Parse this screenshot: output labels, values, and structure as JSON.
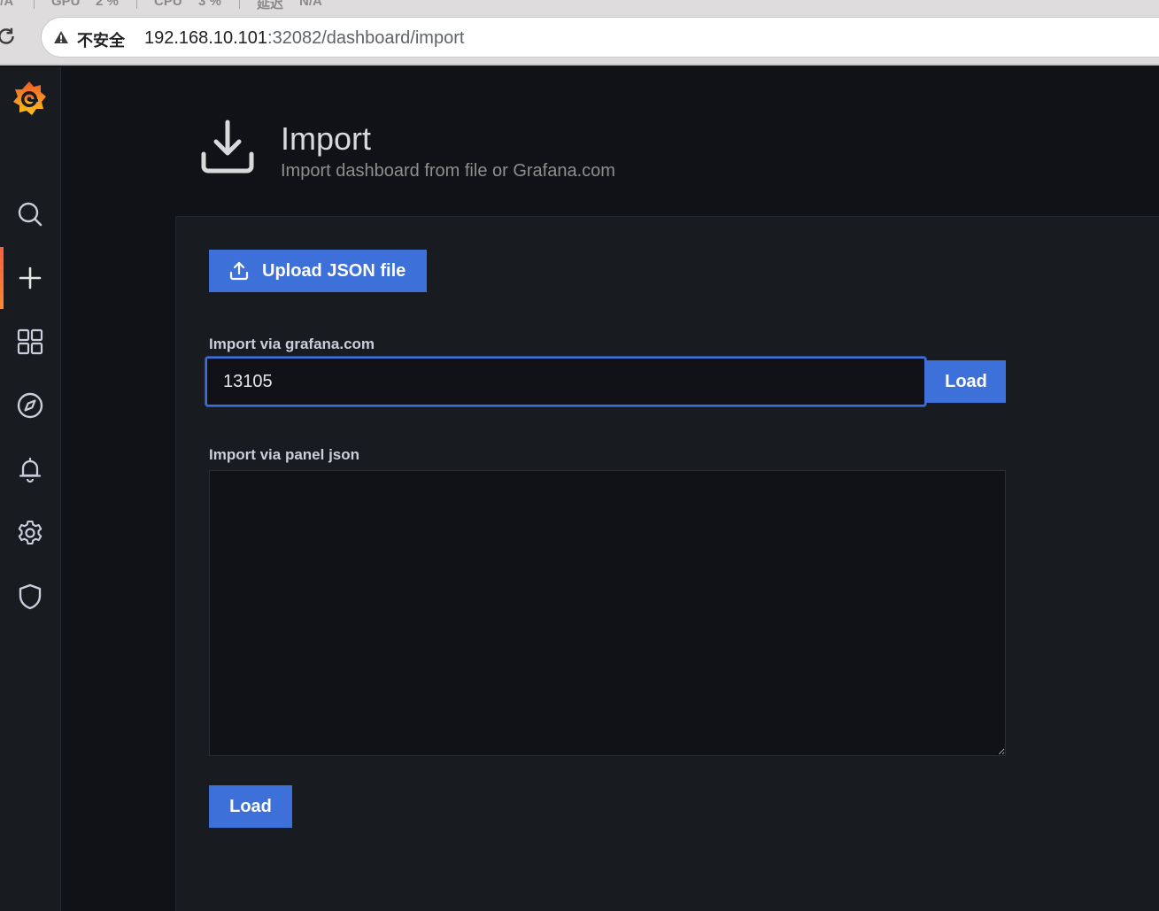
{
  "system_bar": {
    "items": [
      {
        "label": "GPU",
        "value": "2 %"
      },
      {
        "label": "CPU",
        "value": "3 %"
      },
      {
        "label": "延迟",
        "value": "N/A"
      }
    ],
    "left_fragment": "I/A"
  },
  "browser": {
    "security_label": "不安全",
    "url_host": "192.168.10.101",
    "url_rest": ":32082/dashboard/import"
  },
  "sidebar": {
    "items": [
      {
        "name": "search"
      },
      {
        "name": "create",
        "active": true
      },
      {
        "name": "dashboards"
      },
      {
        "name": "explore"
      },
      {
        "name": "alerting"
      },
      {
        "name": "configuration"
      },
      {
        "name": "server-admin"
      }
    ]
  },
  "header": {
    "title": "Import",
    "subtitle": "Import dashboard from file or Grafana.com"
  },
  "form": {
    "upload_label": "Upload JSON file",
    "grafana_com_label": "Import via grafana.com",
    "grafana_com_value": "13105",
    "load_label": "Load",
    "panel_json_label": "Import via panel json",
    "panel_json_value": "",
    "load_bottom_label": "Load"
  },
  "colors": {
    "primary": "#3d71d9",
    "background": "#111217",
    "panel": "#181b1f",
    "accent": "#f55f3e"
  }
}
